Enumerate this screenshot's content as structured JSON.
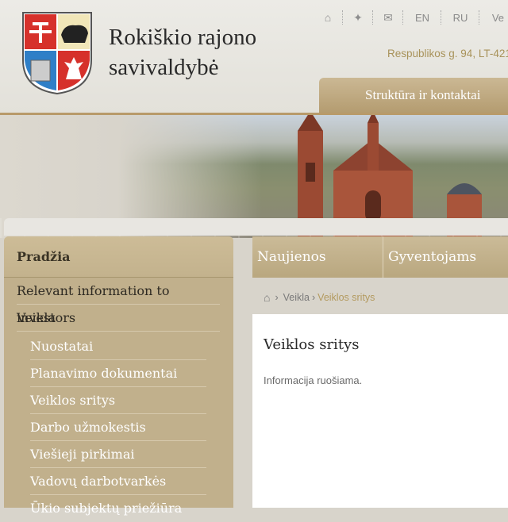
{
  "site": {
    "title_line1": "Rokiškio rajono",
    "title_line2": "savivaldybė",
    "address": "Respublikos g. 94, LT-421"
  },
  "top_nav": {
    "lang_en": "EN",
    "lang_ru": "RU",
    "lang_partial": "Ve"
  },
  "icons": {
    "home": "home-icon",
    "sitemap": "sitemap-icon",
    "mail": "mail-icon"
  },
  "struct_tab": "Struktūra ir kontaktai",
  "main_tabs": [
    "Naujienos",
    "Gyventojams"
  ],
  "sidebar": {
    "header": "Pradžia",
    "items": [
      {
        "label": "Relevant information to investors",
        "level": 1
      },
      {
        "label": "Veikla",
        "level": 1
      },
      {
        "label": "Nuostatai",
        "level": 2
      },
      {
        "label": "Planavimo dokumentai",
        "level": 2
      },
      {
        "label": "Veiklos sritys",
        "level": 2
      },
      {
        "label": "Darbo užmokestis",
        "level": 2
      },
      {
        "label": "Viešieji pirkimai",
        "level": 2
      },
      {
        "label": "Vadovų darbotvarkės",
        "level": 2
      },
      {
        "label": "Ūkio subjektų priežiūra",
        "level": 2
      }
    ]
  },
  "breadcrumb": {
    "sep": "›",
    "item1": "Veikla",
    "current": "Veiklos sritys"
  },
  "content": {
    "heading": "Veiklos sritys",
    "body": "Informacija ruošiama."
  },
  "colors": {
    "accent_gold": "#b89a6a",
    "sidebar_bg": "#c1b08c",
    "breadcrumb_current": "#b39a5f"
  }
}
